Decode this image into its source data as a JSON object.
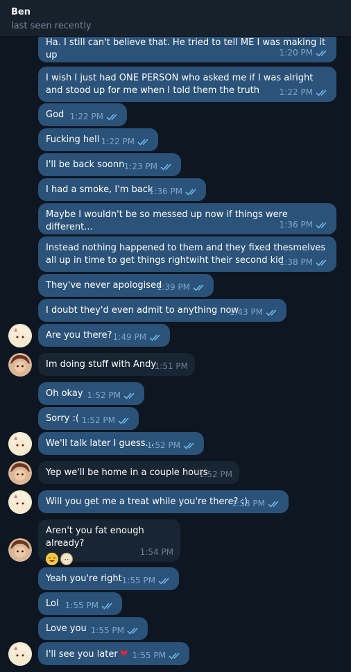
{
  "header": {
    "name": "Ben",
    "status": "last seen recently"
  },
  "messages": [
    {
      "text": "Ha. I still can't believe that. He tried to tell ME I was making it up",
      "time": "1:20 PM"
    },
    {
      "text": "I wish I just had ONE PERSON who asked me if I was alright and stood up for me when I told them the truth",
      "time": "1:22 PM"
    },
    {
      "text": "God",
      "time": "1:22 PM"
    },
    {
      "text": "Fucking hell",
      "time": "1:22 PM"
    },
    {
      "text": "I'll be back soonn",
      "time": "1:23 PM"
    },
    {
      "text": "I had a smoke, I'm back",
      "time": "1:36 PM"
    },
    {
      "text": "Maybe I wouldn't be so messed up now if things were different...",
      "time": "1:36 PM"
    },
    {
      "text": "Instead nothing happened to them and they fixed thesmelves all up in time to get things rightwiht their second kid",
      "time": "1:38 PM"
    },
    {
      "text": "They've never apologised",
      "time": "1:39 PM"
    },
    {
      "text": "I doubt they'd even admit to anything now",
      "time": "1:43 PM"
    },
    {
      "text": "Are you there?",
      "time": "1:49 PM"
    },
    {
      "text": "Im doing stuff with Andy",
      "time": "1:51 PM"
    },
    {
      "text": "Oh okay",
      "time": "1:52 PM"
    },
    {
      "text": "Sorry :(",
      "time": "1:52 PM"
    },
    {
      "text": "We'll talk later I guess...",
      "time": "1:52 PM"
    },
    {
      "text": "Yep we'll be home in a couple hours",
      "time": "1:52 PM"
    },
    {
      "text": "Will you get me a treat while you're there? :)",
      "time": "1:53 PM"
    },
    {
      "text": "Aren't you fat enough already?",
      "time": "1:54 PM"
    },
    {
      "text": "Yeah you're right",
      "time": "1:55 PM"
    },
    {
      "text": "Lol",
      "time": "1:55 PM"
    },
    {
      "text": "Love you",
      "time": "1:55 PM"
    },
    {
      "text": "I'll see you later",
      "time": "1:55 PM"
    }
  ],
  "colors": {
    "outgoing": "#2b5278",
    "incoming": "#182533",
    "background": "#0e1621",
    "header": "#17212b"
  }
}
